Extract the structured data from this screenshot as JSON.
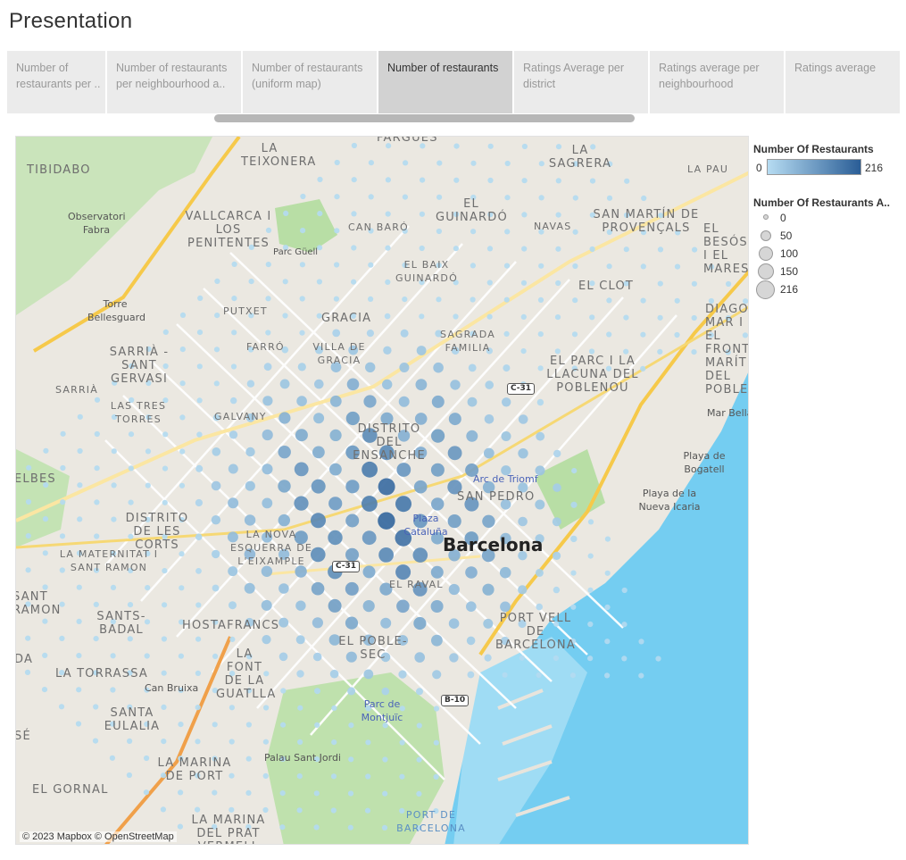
{
  "title": "Presentation",
  "tabs": [
    {
      "label": "Number of restaurants per ..",
      "active": false
    },
    {
      "label": "Number of restaurants per neighbourhood a..",
      "active": false
    },
    {
      "label": "Number of restaurants (uniform map)",
      "active": false
    },
    {
      "label": "Number of restaurants",
      "active": true
    },
    {
      "label": "Ratings Average per district",
      "active": false
    },
    {
      "label": "Ratings average per neighbourhood",
      "active": false
    },
    {
      "label": "Ratings average",
      "active": false
    }
  ],
  "legend": {
    "color_title": "Number Of Restaurants",
    "color_min": "0",
    "color_max": "216",
    "color_low": "#b6dcf2",
    "color_high": "#2a5d96",
    "size_title": "Number Of Restaurants A..",
    "size_items": [
      "0",
      "50",
      "100",
      "150",
      "216"
    ]
  },
  "map": {
    "attribution": "© 2023 Mapbox © OpenStreetMap",
    "place_labels": [
      "FARGUES",
      "LA TEIXONERA",
      "TIBIDABO",
      "VALLCARCA I LOS PENITENTES",
      "EL GUINARDÓ",
      "CAN BARÓ",
      "LA SAGRERA",
      "LA PAU",
      "SAN MARTÍN DE PROVENÇALS",
      "EL BESÓS I EL MARESME",
      "NAVAS",
      "EL BAIX GUINARDÓ",
      "EL CLOT",
      "DIAGONAL MAR I EL FRONT MARÍTIM DEL POBLENOU",
      "PUTXET",
      "GRACIA",
      "FARRÓ",
      "VILLA DE GRACIA",
      "SAGRADA FAMILIA",
      "EL PARC I LA LLACUNA DEL POBLENOU",
      "SARRIÀ - SANT GERVASI",
      "SARRIÀ",
      "LAS TRES TORRES",
      "GALVANY",
      "DISTRITO DEL ENSANCHE",
      "SAN PEDRO",
      "ELBES",
      "DISTRITO DE LES CORTS",
      "LA MATERNITAT I SANT RAMON",
      "LA NOVA ESQUERRA DE L'EIXAMPLE",
      "EL RAVAL",
      "SANT RAMON",
      "SANTS-BADAL",
      "HOSTAFRANCS",
      "EL POBLE-SEC",
      "PORT VELL DE BARCELONA",
      "DA",
      "LA TORRASSA",
      "LA FONT DE LA GUATLLA",
      "SANTA EULALIA",
      "SÉ",
      "LA MARINA DE PORT",
      "EL GORNAL",
      "PORT DE BARCELONA",
      "LA MARINA DEL PRAT VERMELL"
    ],
    "poi_labels": [
      "Observatori Fabra",
      "Parc Güell",
      "Torre Bellesguard",
      "Arc de Triomf",
      "Plaza Cataluña",
      "Parc de Montjuïc",
      "Can Bruixa",
      "Palau Sant Jordi",
      "Mar Bella",
      "Playa de Bogatell",
      "Playa de la Nueva Icaria"
    ],
    "city_label": "Barcelona",
    "road_shields": [
      "C-31",
      "C-31",
      "B-10"
    ],
    "big_bubble_counts": [
      216,
      180,
      170,
      160,
      150,
      140,
      130,
      120,
      110,
      100,
      90,
      80,
      70,
      60,
      50,
      40,
      30
    ]
  }
}
